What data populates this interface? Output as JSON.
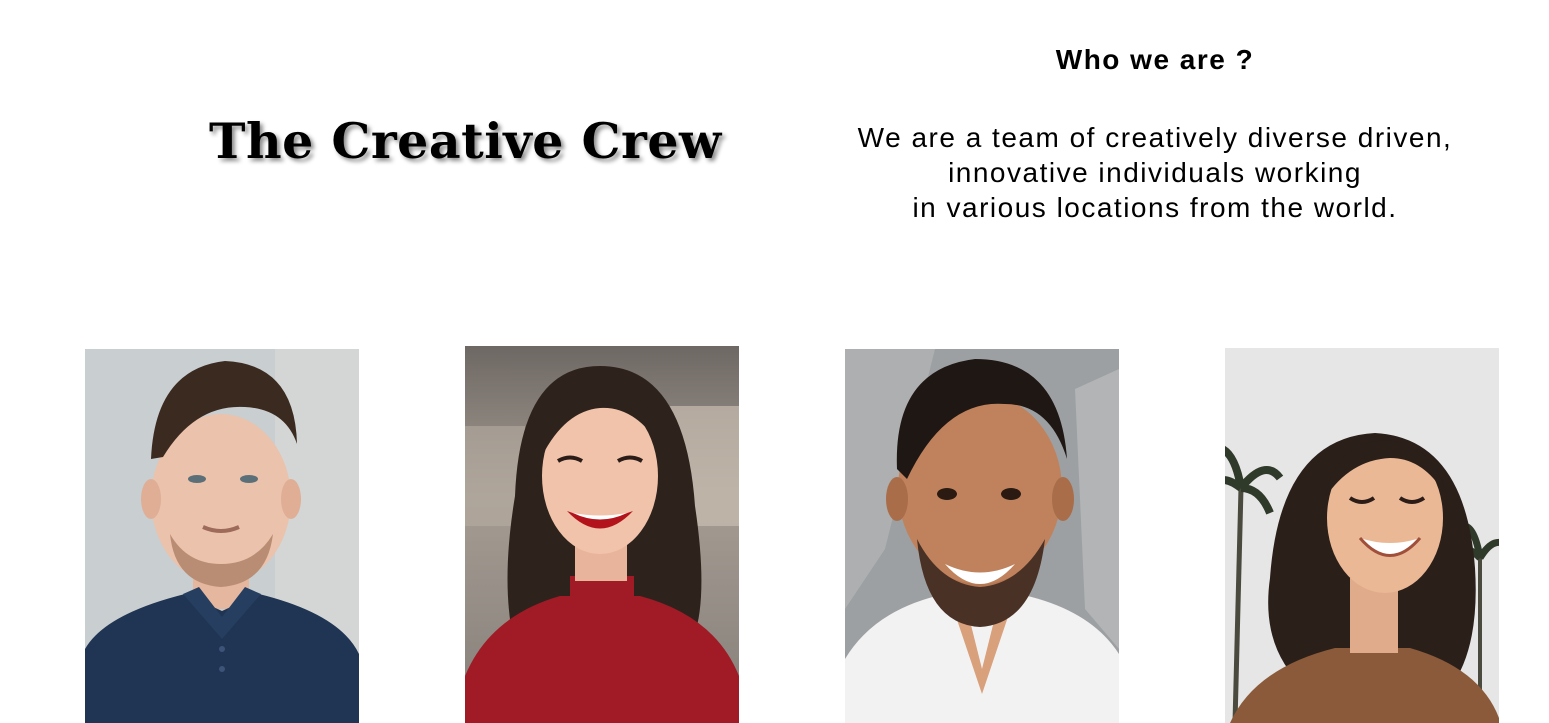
{
  "header": {
    "brand_title": "The Creative Crew"
  },
  "about": {
    "heading": "Who we are ?",
    "lines": [
      "We are a team of creatively diverse driven,",
      "innovative individuals working",
      "in various locations from the world."
    ]
  },
  "team": {
    "photos": [
      {
        "subject": "man in navy polo shirt",
        "background": "#c9ced0",
        "clothing": "#1f3553"
      },
      {
        "subject": "smiling woman in red sweater",
        "background": "#8d8680",
        "clothing": "#a01b25"
      },
      {
        "subject": "smiling man in white v-neck",
        "background": "#9da0a2",
        "clothing": "#f2f2f2"
      },
      {
        "subject": "laughing woman with palm trees",
        "background": "#e6e6e6",
        "clothing": "#8a5a3a"
      }
    ]
  }
}
